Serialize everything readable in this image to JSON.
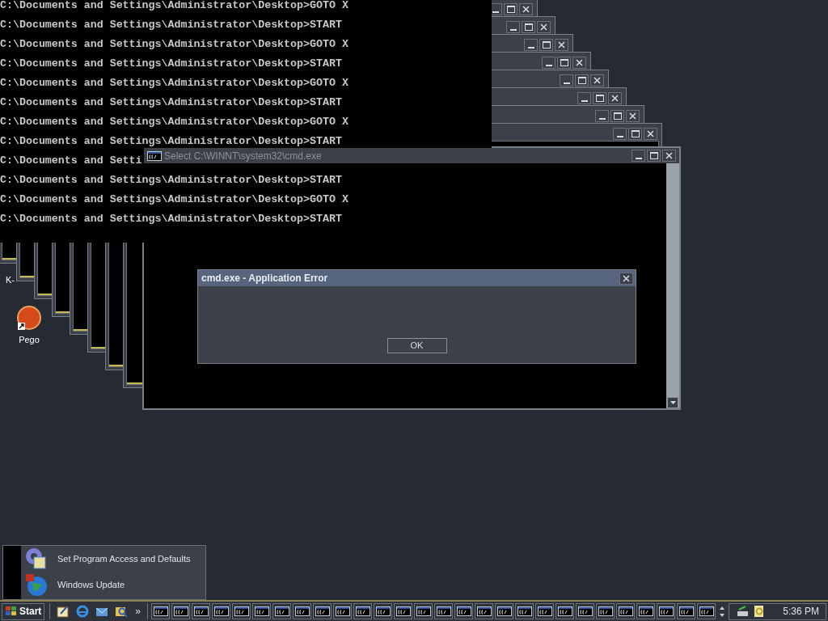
{
  "console": {
    "lines": [
      "C:\\Documents and Settings\\Administrator\\Desktop>GOTO X",
      "C:\\Documents and Settings\\Administrator\\Desktop>START",
      "C:\\Documents and Settings\\Administrator\\Desktop>GOTO X",
      "C:\\Documents and Settings\\Administrator\\Desktop>START",
      "C:\\Documents and Settings\\Administrator\\Desktop>GOTO X",
      "C:\\Documents and Settings\\Administrator\\Desktop>START",
      "C:\\Documents and Settings\\Administrator\\Desktop>GOTO X",
      "C:\\Documents and Settings\\Administrator\\Desktop>START",
      "C:\\Documents and Setti",
      "C:\\Documents and Settings\\Administrator\\Desktop>START",
      "C:\\Documents and Settings\\Administrator\\Desktop>GOTO X",
      "C:\\Documents and Settings\\Administrator\\Desktop>START"
    ]
  },
  "select_window": {
    "title": "Select C:\\WINNT\\system32\\cmd.exe"
  },
  "error_dialog": {
    "title": "cmd.exe - Application Error",
    "button": "OK"
  },
  "desktop_icons": [
    {
      "kind": "hidden",
      "label": "K-"
    },
    {
      "kind": "ball",
      "label": "Pego"
    }
  ],
  "start_menu": {
    "items": [
      {
        "kind": "settings",
        "label": "Set Program Access and Defaults"
      },
      {
        "kind": "globe",
        "label": "Windows Update"
      }
    ]
  },
  "taskbar": {
    "start": "Start",
    "chevron": "»",
    "quick_launch": [
      {
        "kind": "desktop"
      },
      {
        "kind": "browser"
      },
      {
        "kind": "mail"
      },
      {
        "kind": "search"
      }
    ],
    "task_buttons": [
      {
        "kind": "console"
      },
      {
        "kind": "console"
      },
      {
        "kind": "console"
      },
      {
        "kind": "console"
      },
      {
        "kind": "console"
      },
      {
        "kind": "console"
      },
      {
        "kind": "console"
      },
      {
        "kind": "console"
      },
      {
        "kind": "console"
      },
      {
        "kind": "console"
      },
      {
        "kind": "console"
      },
      {
        "kind": "console"
      },
      {
        "kind": "console"
      },
      {
        "kind": "console"
      },
      {
        "kind": "console"
      },
      {
        "kind": "console"
      },
      {
        "kind": "console"
      },
      {
        "kind": "console"
      },
      {
        "kind": "console"
      },
      {
        "kind": "console"
      },
      {
        "kind": "console"
      },
      {
        "kind": "console"
      },
      {
        "kind": "console"
      },
      {
        "kind": "console"
      },
      {
        "kind": "console"
      },
      {
        "kind": "console"
      },
      {
        "kind": "console"
      },
      {
        "kind": "console"
      }
    ],
    "clock": "5:36 PM"
  }
}
